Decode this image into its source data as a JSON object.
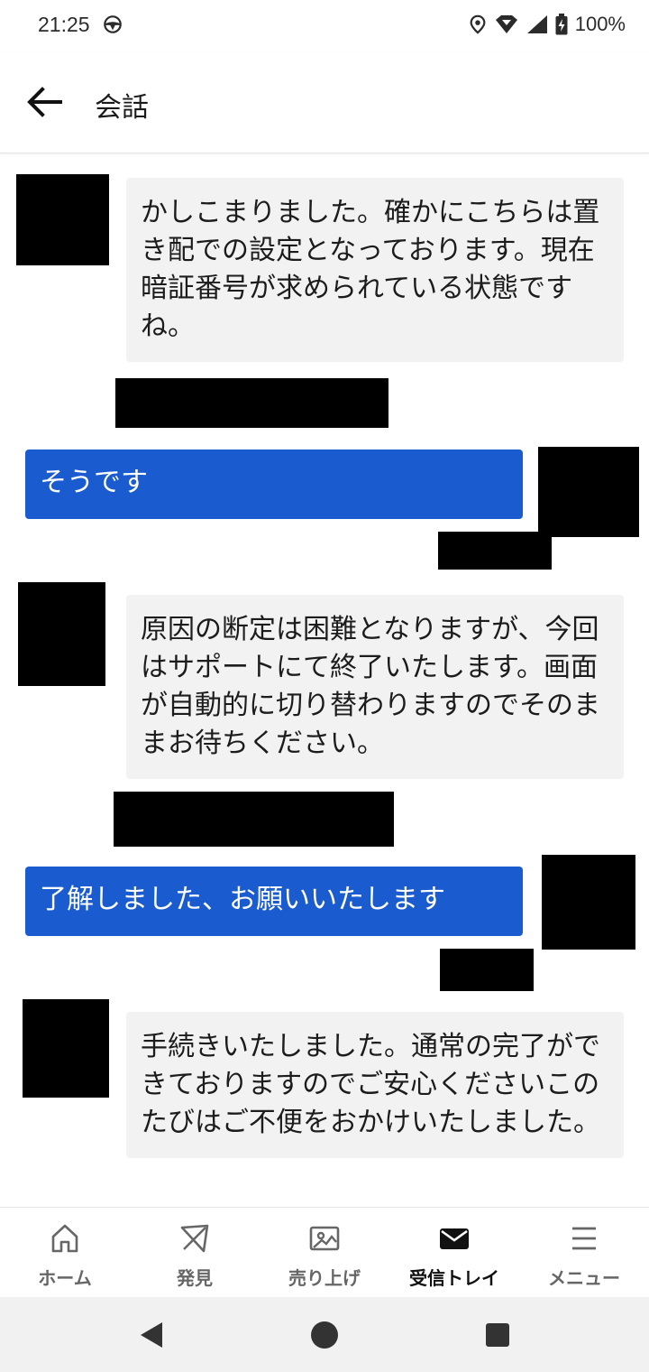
{
  "status_bar": {
    "time": "21:25",
    "battery": "100%",
    "icons": [
      "steering-wheel-icon",
      "location-icon",
      "wifi-icon",
      "signal-icon",
      "battery-icon"
    ]
  },
  "header": {
    "title": "会話",
    "back_icon": "arrow-left-icon"
  },
  "messages": [
    {
      "direction": "incoming",
      "text": "かしこまりました。確かにこちらは置き配での設定となっております。現在暗証番号が求められている状態ですね。"
    },
    {
      "direction": "outgoing",
      "text": "そうです"
    },
    {
      "direction": "incoming",
      "text": "原因の断定は困難となりますが、今回はサポートにて終了いたします。画面が自動的に切り替わりますのでそのままお待ちください。"
    },
    {
      "direction": "outgoing",
      "text": "了解しました、お願いいたします"
    },
    {
      "direction": "incoming",
      "text": "手続きいたしました。通常の完了ができておりますのでご安心くださいこのたびはご不便をおかけいたしました。"
    }
  ],
  "nav": {
    "items": [
      {
        "label": "ホーム",
        "icon": "home-icon",
        "active": false
      },
      {
        "label": "発見",
        "icon": "compass-icon",
        "active": false
      },
      {
        "label": "売り上げ",
        "icon": "money-icon",
        "active": false
      },
      {
        "label": "受信トレイ",
        "icon": "mail-icon",
        "active": true
      },
      {
        "label": "メニュー",
        "icon": "menu-icon",
        "active": false
      }
    ]
  },
  "colors": {
    "outgoing_bubble": "#1a5ccf",
    "incoming_bubble": "#f2f2f2",
    "nav_label": "#666666",
    "nav_active": "#111111"
  }
}
